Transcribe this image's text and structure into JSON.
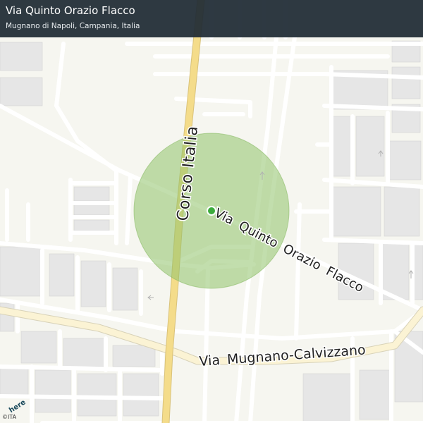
{
  "header": {
    "title": "Via Quinto Orazio Flacco",
    "subtitle": "Mugnano di Napoli, Campania, Italia"
  },
  "map": {
    "street_labels": {
      "corso_italia": "Corso Italia",
      "via_quinto_orazio_flacco": "Via Quinto Orazio Flacco",
      "via_mugnano_calvizzano": "Via Mugnano-Calvizzano"
    },
    "accuracy_circle_color": "#a6cf86",
    "location_dot_color": "#3cab3c",
    "highway_color": "#f4dc8a",
    "road_color": "#ffffff",
    "block_color": "#e8e8e8",
    "background_color": "#f6f6f0"
  },
  "branding": {
    "logo_text": "here",
    "copyright": "©ITA"
  }
}
